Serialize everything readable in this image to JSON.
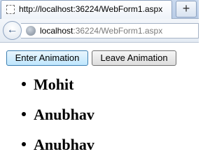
{
  "browser": {
    "tab_title": "http://localhost:36224/WebForm1.aspx",
    "new_tab_symbol": "+",
    "back_symbol": "←",
    "url_host": "localhost",
    "url_rest": ":36224/WebForm1.aspx"
  },
  "page": {
    "buttons": {
      "enter": "Enter Animation",
      "leave": "Leave Animation"
    },
    "list_items": [
      "Mohit",
      "Anubhav",
      "Anubhav"
    ]
  }
}
